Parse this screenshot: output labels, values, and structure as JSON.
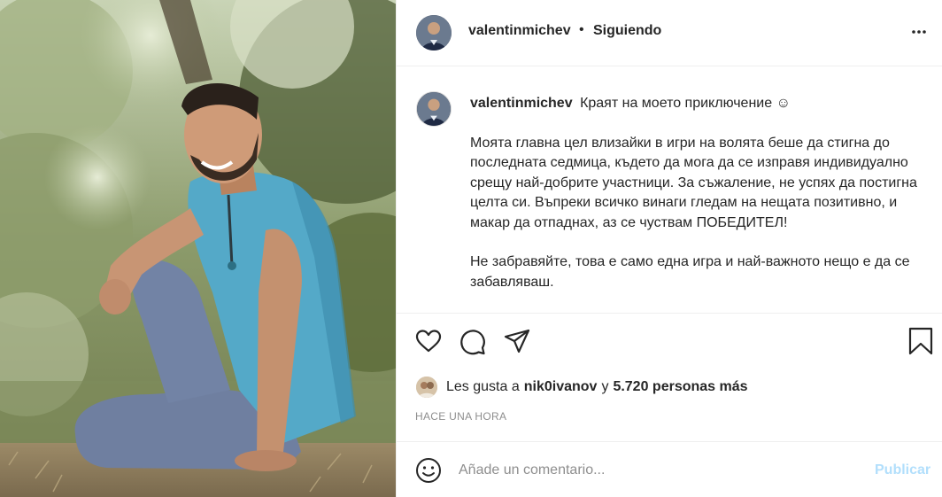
{
  "post": {
    "username": "valentinmichev",
    "separator": "•",
    "follow_status": "Siguiendo",
    "caption": {
      "username": "valentinmichev",
      "title": "Краят на моето приключение ☺",
      "paragraph1": "Моята главна цел влизайки в игри на волята беше да стигна до последната седмица, където да мога да се изправя индивидуално срещу най-добрите участници. За съжаление, не успях да постигна целта си. Въпреки всичко винаги гледам на нещата позитивно, и макар да отпаднах, аз се чуствам ПОБЕДИТЕЛ!",
      "paragraph2": "Не забравяйте, това е само една игра и най-важното нещо е да се забавляваш."
    },
    "likes": {
      "prefix": "Les gusta a",
      "user": "nik0ivanov",
      "conjunction": "y",
      "others": "5.720 personas más"
    },
    "timestamp": "HACE UNA HORA",
    "comment": {
      "placeholder": "Añade un comentario...",
      "publish_label": "Publicar"
    }
  },
  "icons": {
    "more": "more-options-icon",
    "like": "heart-icon",
    "comment": "comment-icon",
    "share": "share-icon",
    "save": "bookmark-icon",
    "emoji": "emoji-icon"
  },
  "colors": {
    "text": "#262626",
    "muted": "#8e8e8e",
    "divider": "#efefef",
    "publish_disabled": "#b2dffc"
  }
}
